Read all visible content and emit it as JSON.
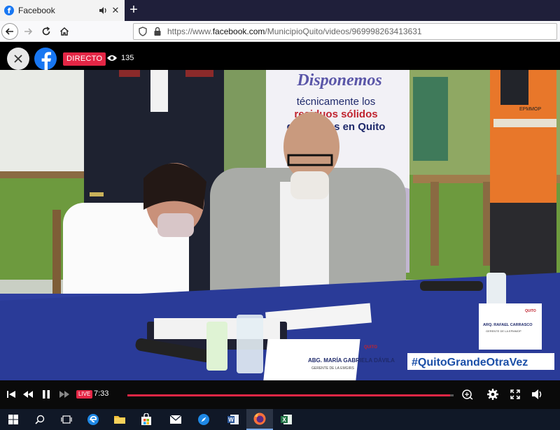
{
  "browser": {
    "tab_title": "Facebook",
    "new_tab_label": "+",
    "url_prefix": "https://www.",
    "url_domain": "facebook.com",
    "url_path": "/MunicipioQuito/videos/969998263413631"
  },
  "player": {
    "live_badge": "DIRECTO",
    "viewer_count": "135",
    "time": "7:33",
    "live_small": "LIVE",
    "progress": 0.99
  },
  "scene": {
    "banner_line1": "Disponemos",
    "banner_line2": "técnicamente los",
    "banner_line3": "residuos sólidos",
    "banner_line4": "generados en Quito",
    "vest_text": "EPMMOP",
    "card_front_tag": "QUITO",
    "card_front_name": "ABG. MARÍA GABRIELA DÁVILA",
    "card_front_role": "GERENTE DE LA EMGIRS",
    "card_back_tag": "QUITO",
    "card_back_name": "ARQ. RAFAEL CARRASCO",
    "card_back_role": "GERENTE DE LA EPMMOP",
    "hashtag": "#QuitoGrandeOtraVez"
  },
  "icons": {
    "close": "close-icon",
    "facebook": "facebook-icon",
    "eye": "eye-icon"
  },
  "colors": {
    "facebook_blue": "#1877f2",
    "live_red": "#e42645",
    "hashtag_blue": "#1b4fa8"
  }
}
